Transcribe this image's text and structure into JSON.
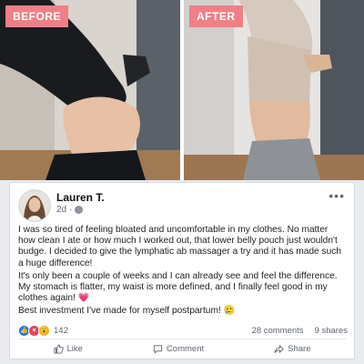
{
  "photos": {
    "before_label": "BEFORE",
    "after_label": "AFTER"
  },
  "post": {
    "author": "Lauren T.",
    "time": "2d",
    "paragraphs": [
      "I was so tired of feeling bloated and uncomfortable in my clothes. No matter how clean I ate or how much I worked out, that lower belly pouch just wouldn't budge. I decided to give the lymphatic ab massager a try and it has made such a huge difference!",
      "It's only been a couple of weeks and I can already see and feel the difference. My stomach is flatter, my waist is more defined, and I finally feel good in my clothes again! 💗",
      "Best investment I've made for myself postpartum! 🥲"
    ],
    "reaction_count": "142",
    "comments": "28 comments",
    "shares": "9 shares"
  },
  "actions": {
    "like": "Like",
    "comment": "Comment",
    "share": "Share"
  },
  "icons": [
    "like-reaction-icon",
    "love-reaction-icon",
    "wow-reaction-icon",
    "globe-icon",
    "more-options-icon",
    "like-icon",
    "comment-icon",
    "share-icon"
  ]
}
